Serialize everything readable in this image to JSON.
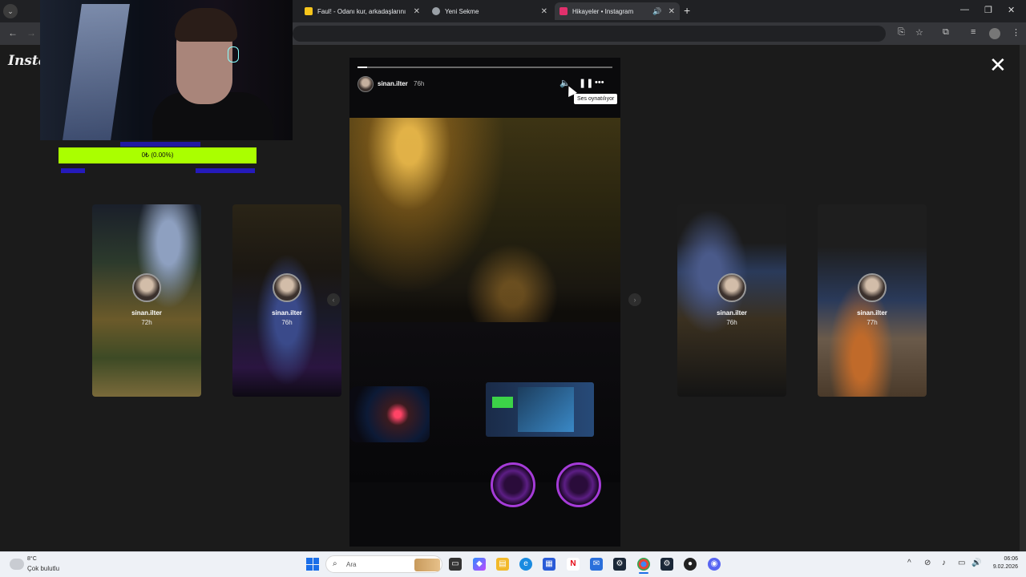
{
  "browser": {
    "tabs": [
      {
        "label": "Faul! - Odanı kur, arkadaşlarını",
        "favicon_color": "#f7c51b"
      },
      {
        "label": "Yeni Sekme",
        "favicon_color": "#9aa0a6"
      },
      {
        "label": "Hikayeler • Instagram",
        "favicon_color": "#e1306c",
        "active": true
      }
    ]
  },
  "instagram": {
    "logo": "Instag",
    "story": {
      "username": "sinan.ilter",
      "time": "76h",
      "tooltip": "Ses oynatılıyor"
    },
    "cards": [
      {
        "username": "sinan.ilter",
        "time": "72h"
      },
      {
        "username": "sinan.ilter",
        "time": "76h"
      },
      {
        "username": "sinan.ilter",
        "time": "76h"
      },
      {
        "username": "sinan.ilter",
        "time": "77h"
      }
    ]
  },
  "overlay": {
    "progress_text": "0₺ (0.00%)",
    "progress_fraction": 0.0,
    "bar_color": "#aaff00"
  },
  "taskbar": {
    "weather_temp": "8°C",
    "weather_desc": "Çok bulutlu",
    "search_placeholder": "Ara",
    "clock_time": "06:06",
    "clock_date": "9.02.2026"
  }
}
